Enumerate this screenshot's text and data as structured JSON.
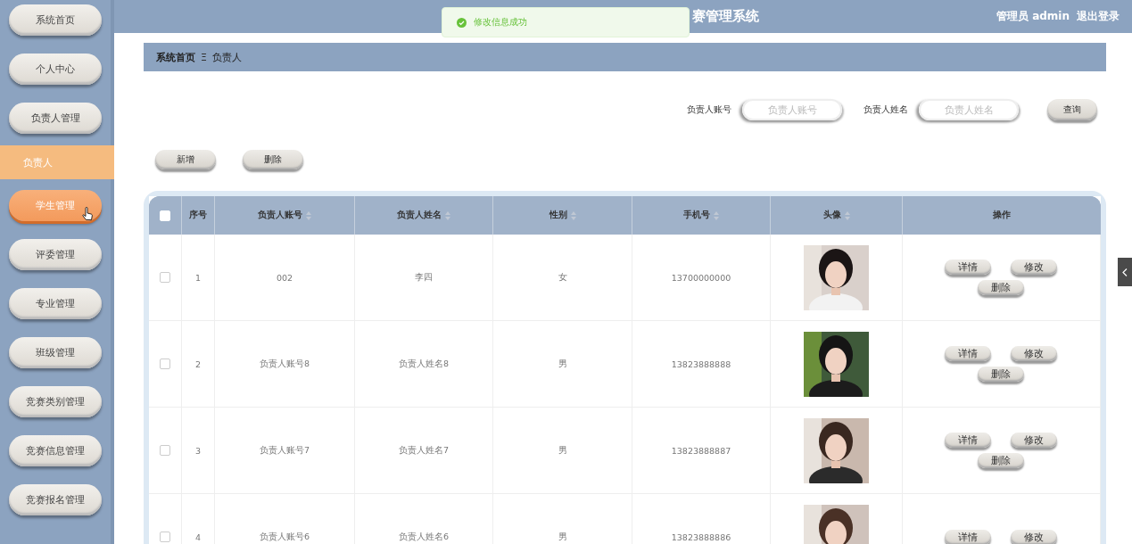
{
  "header": {
    "title": "赛管理系统",
    "user": "管理员 admin",
    "logout": "退出登录"
  },
  "toast": {
    "message": "修改信息成功"
  },
  "sidebar": {
    "items": [
      {
        "label": "系统首页",
        "hovered": false
      },
      {
        "label": "个人中心",
        "hovered": false
      },
      {
        "label": "负责人管理",
        "hovered": false,
        "children": [
          {
            "label": "负责人",
            "selected": true
          }
        ]
      },
      {
        "label": "学生管理",
        "hovered": true
      },
      {
        "label": "评委管理",
        "hovered": false
      },
      {
        "label": "专业管理",
        "hovered": false
      },
      {
        "label": "班级管理",
        "hovered": false
      },
      {
        "label": "竞赛类别管理",
        "hovered": false
      },
      {
        "label": "竞赛信息管理",
        "hovered": false
      },
      {
        "label": "竞赛报名管理",
        "hovered": false
      }
    ]
  },
  "breadcrumb": {
    "items": [
      "系统首页",
      "负责人"
    ],
    "separator": "Ξ"
  },
  "search": {
    "fields": [
      {
        "label": "负责人账号",
        "placeholder": "负责人账号"
      },
      {
        "label": "负责人姓名",
        "placeholder": "负责人姓名"
      }
    ],
    "button": "查询"
  },
  "actions": [
    "新增",
    "删除"
  ],
  "table": {
    "columns": [
      {
        "label": "序号",
        "sortable": false
      },
      {
        "label": "负责人账号",
        "sortable": true
      },
      {
        "label": "负责人姓名",
        "sortable": true
      },
      {
        "label": "性别",
        "sortable": true
      },
      {
        "label": "手机号",
        "sortable": true
      },
      {
        "label": "头像",
        "sortable": true
      },
      {
        "label": "操作",
        "sortable": false
      }
    ],
    "header_checked": false,
    "rows": [
      {
        "checked": false,
        "cells": [
          "1",
          "002",
          "李四",
          "女",
          "13700000000"
        ],
        "avatar": {
          "kind": "picture"
        },
        "buttons": [
          "详情",
          "修改",
          "删除"
        ]
      },
      {
        "checked": false,
        "cells": [
          "2",
          "负责人账号8",
          "负责人姓名8",
          "男",
          "13823888888"
        ],
        "avatar": {
          "kind": "picture"
        },
        "buttons": [
          "详情",
          "修改",
          "删除"
        ]
      },
      {
        "checked": false,
        "cells": [
          "3",
          "负责人账号7",
          "负责人姓名7",
          "男",
          "13823888887"
        ],
        "avatar": {
          "kind": "picture"
        },
        "buttons": [
          "详情",
          "修改",
          "删除"
        ]
      },
      {
        "checked": false,
        "cells": [
          "4",
          "负责人账号6",
          "负责人姓名6",
          "男",
          "13823888886"
        ],
        "avatar": {
          "kind": "picture"
        },
        "buttons": [
          "详情",
          "修改"
        ]
      }
    ]
  }
}
